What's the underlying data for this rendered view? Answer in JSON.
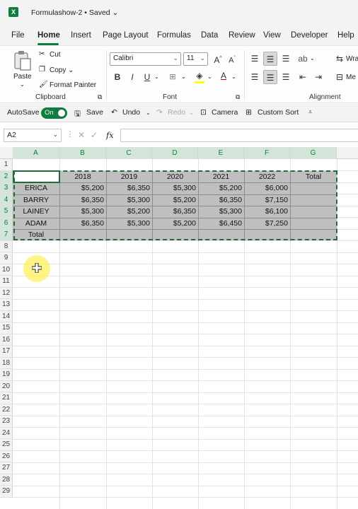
{
  "window": {
    "title": "Formulashow-2 • Saved",
    "app_icon": "X"
  },
  "menu": [
    "File",
    "Home",
    "Insert",
    "Page Layout",
    "Formulas",
    "Data",
    "Review",
    "View",
    "Developer",
    "Help"
  ],
  "ribbon": {
    "clipboard": {
      "paste": "Paste",
      "cut": "Cut",
      "copy": "Copy",
      "format_painter": "Format Painter",
      "label": "Clipboard"
    },
    "font": {
      "name": "Calibri",
      "size": "11",
      "bold": "B",
      "italic": "I",
      "underline": "U",
      "grow": "A",
      "shrink": "A",
      "font_color": "A",
      "label": "Font"
    },
    "alignment": {
      "wrap": "Wra",
      "merge": "Me",
      "label": "Alignment"
    }
  },
  "qat": {
    "autosave": "AutoSave",
    "autosave_state": "On",
    "save": "Save",
    "undo": "Undo",
    "redo": "Redo",
    "camera": "Camera",
    "custom_sort": "Custom Sort"
  },
  "formula_bar": {
    "name_box": "A2",
    "cancel": "✕",
    "enter": "✓",
    "fx": "fx",
    "value": ""
  },
  "columns": [
    "A",
    "B",
    "C",
    "D",
    "E",
    "F",
    "G"
  ],
  "rows": [
    "1",
    "2",
    "3",
    "4",
    "5",
    "6",
    "7",
    "8",
    "9",
    "10",
    "11",
    "12",
    "13",
    "14",
    "15",
    "16",
    "17",
    "18",
    "19",
    "20",
    "21",
    "22",
    "23",
    "24",
    "25",
    "26",
    "27",
    "28",
    "29"
  ],
  "sheet": {
    "headers": [
      "",
      "2018",
      "2019",
      "2020",
      "2021",
      "2022",
      "Total"
    ],
    "data": [
      [
        "ERICA",
        "$5,200",
        "$6,350",
        "$5,300",
        "$5,200",
        "$6,000",
        ""
      ],
      [
        "BARRY",
        "$6,350",
        "$5,300",
        "$5,200",
        "$6,350",
        "$7,150",
        ""
      ],
      [
        "LAINEY",
        "$5,300",
        "$5,200",
        "$6,350",
        "$5,300",
        "$6,100",
        ""
      ],
      [
        "ADAM",
        "$6,350",
        "$5,300",
        "$5,200",
        "$6,450",
        "$7,250",
        ""
      ]
    ],
    "total_row": [
      "Total",
      "",
      "",
      "",
      "",
      "",
      ""
    ]
  },
  "colors": {
    "accent": "#107c41",
    "marquee": "#1f6b3a",
    "fill_gray": "#bfbfbf",
    "cursor_halo": "#fff05a"
  }
}
